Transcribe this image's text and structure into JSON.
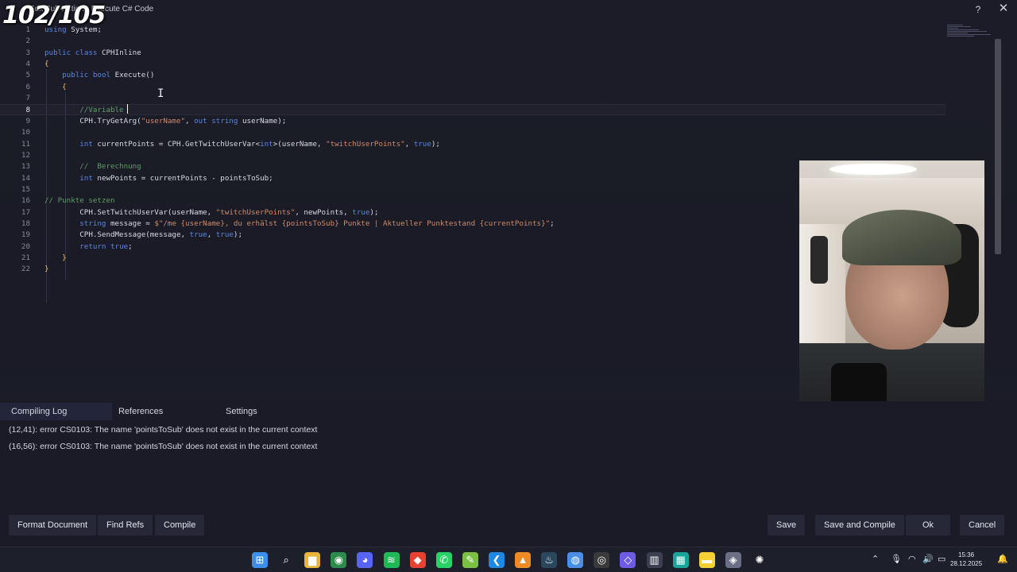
{
  "window": {
    "title": "Edit Sub-Action - Execute C# Code",
    "counter": "102/105",
    "help_label": "?",
    "close_label": "✕"
  },
  "editor": {
    "lines": [
      {
        "n": "1",
        "text": "using System;"
      },
      {
        "n": "2",
        "text": ""
      },
      {
        "n": "3",
        "text": "public class CPHInline"
      },
      {
        "n": "4",
        "text": "{"
      },
      {
        "n": "5",
        "text": "    public bool Execute()"
      },
      {
        "n": "6",
        "text": "    {"
      },
      {
        "n": "7",
        "text": ""
      },
      {
        "n": "8",
        "text": "        //Variable"
      },
      {
        "n": "9",
        "text": "        CPH.TryGetArg(\"userName\", out string userName);"
      },
      {
        "n": "10",
        "text": ""
      },
      {
        "n": "11",
        "text": "        int currentPoints = CPH.GetTwitchUserVar<int>(userName, \"twitchUserPoints\", true);"
      },
      {
        "n": "12",
        "text": ""
      },
      {
        "n": "13",
        "text": "        //  Berechnung"
      },
      {
        "n": "14",
        "text": "        int newPoints = currentPoints - pointsToSub;"
      },
      {
        "n": "15",
        "text": ""
      },
      {
        "n": "16",
        "text": "// Punkte setzen"
      },
      {
        "n": "17",
        "text": "        CPH.SetTwitchUserVar(userName, \"twitchUserPoints\", newPoints, true);"
      },
      {
        "n": "18",
        "text": "        string message = $\"/me {userName}, du erhälst {pointsToSub} Punkte | Aktueller Punktestand {currentPoints}\";"
      },
      {
        "n": "19",
        "text": "        CPH.SendMessage(message, true, true);"
      },
      {
        "n": "20",
        "text": "        return true;"
      },
      {
        "n": "21",
        "text": "    }"
      },
      {
        "n": "22",
        "text": "}"
      }
    ],
    "active_line": "8"
  },
  "panel": {
    "tabs": [
      "Compiling Log",
      "References",
      "Settings"
    ],
    "log": [
      "(12,41): error CS0103: The name 'pointsToSub' does not exist in the current context",
      "(16,56): error CS0103: The name 'pointsToSub' does not exist in the current context"
    ]
  },
  "buttons": {
    "format": "Format Document",
    "find_refs": "Find Refs",
    "compile": "Compile",
    "save": "Save",
    "save_compile": "Save and Compile",
    "ok": "Ok",
    "cancel": "Cancel"
  },
  "taskbar": {
    "apps": [
      "windows-start-icon",
      "search-icon",
      "file-explorer-icon",
      "chrome-icon",
      "discord-icon",
      "spotify-icon",
      "git-icon",
      "whatsapp-icon",
      "notepad-plus-icon",
      "vscode-icon",
      "vlc-icon",
      "steam-icon",
      "browser-icon",
      "obs-icon",
      "streamerbot-icon",
      "audio-icon",
      "nvidia-icon",
      "sticky-notes-icon",
      "davinci-icon",
      "chatgpt-icon"
    ],
    "time": "15:36",
    "date": "28.12.2025"
  },
  "colors": {
    "keyword": "#5a86e0",
    "string": "#d08a6a",
    "comment": "#5f9e64",
    "background": "#1a1b26"
  }
}
